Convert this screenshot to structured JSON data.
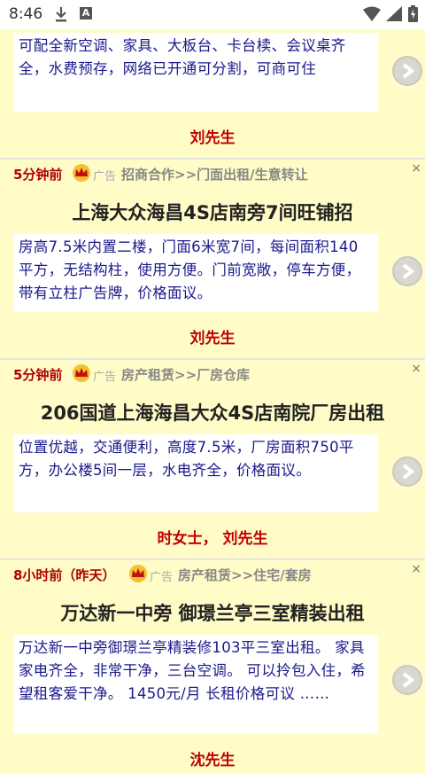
{
  "status_bar": {
    "time": "8:46",
    "app_badge": "A"
  },
  "listings": [
    {
      "time": "",
      "ad": "",
      "category": "",
      "title": "",
      "description": "可配全新空调、家具、大板台、卡台椟、会议桌齐全，水费预存，网络已开通可分割，可商可住",
      "contact": "刘先生"
    },
    {
      "time": "5分钟前",
      "ad": "广告",
      "category": "招商合作>>门面出租/生意转让",
      "title": "上海大众海昌4S店南旁7间旺铺招",
      "description": "房高7.5米内置二楼，门面6米宽7间，每间面积140平方，无结构柱，使用方便。门前宽敞，停车方便，带有立柱广告牌，价格面议。",
      "contact": "刘先生"
    },
    {
      "time": "5分钟前",
      "ad": "广告",
      "category": "房产租赁>>厂房仓库",
      "title": "206国道上海海昌大众4S店南院厂房出租",
      "description": "位置优越，交通便利，高度7.5米，厂房面积750平方，办公楼5间一层，水电齐全，价格面议。",
      "contact": "时女士， 刘先生"
    },
    {
      "time": "8小时前（昨天）",
      "ad": "广告",
      "category": "房产租赁>>住宅/套房",
      "title": "万达新一中旁 御璟兰亭三室精装出租",
      "description": "万达新一中旁御璟兰亭精装修103平三室出租。 家具家电齐全，非常干净，三台空调。 可以拎包入住，希望租客爱干净。 1450元/月 长租价格可议 ……",
      "contact": "沈先生"
    }
  ],
  "close_glyph": "×"
}
